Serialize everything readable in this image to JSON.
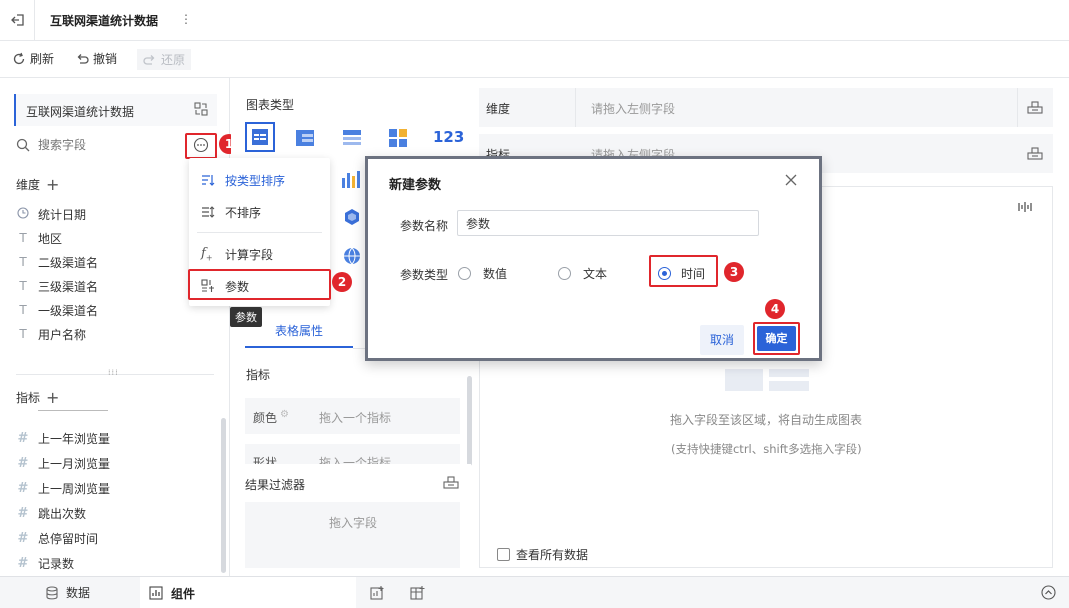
{
  "app": {
    "title": "互联网渠道统计数据",
    "more_glyph": "⋮"
  },
  "toolbar": {
    "refresh": "刷新",
    "undo": "撤销",
    "redo": "还原"
  },
  "left": {
    "dataset_name": "互联网渠道统计数据",
    "search_placeholder": "搜索字段",
    "dimension_title": "维度",
    "dimensions": [
      {
        "icon": "calendar-icon",
        "label": "统计日期"
      },
      {
        "icon": "text-field-icon",
        "label": "地区"
      },
      {
        "icon": "text-field-icon",
        "label": "二级渠道名"
      },
      {
        "icon": "text-field-icon",
        "label": "三级渠道名"
      },
      {
        "icon": "text-field-icon",
        "label": "一级渠道名"
      },
      {
        "icon": "text-field-icon",
        "label": "用户名称"
      }
    ],
    "metric_title": "指标",
    "metrics": [
      {
        "icon": "number-field-icon",
        "label": "上一年浏览量"
      },
      {
        "icon": "number-field-icon",
        "label": "上一月浏览量"
      },
      {
        "icon": "number-field-icon",
        "label": "上一周浏览量"
      },
      {
        "icon": "number-field-icon",
        "label": "跳出次数"
      },
      {
        "icon": "number-field-icon",
        "label": "总停留时间"
      },
      {
        "icon": "number-field-icon",
        "label": "记录数"
      }
    ]
  },
  "menu": {
    "items": [
      {
        "icon": "sort-by-type-icon",
        "label": "按类型排序"
      },
      {
        "icon": "no-sort-icon",
        "label": "不排序"
      },
      {
        "icon": "calc-field-icon",
        "label": "计算字段"
      },
      {
        "icon": "parameter-icon",
        "label": "参数"
      }
    ],
    "tooltip": "参数"
  },
  "middle": {
    "chart_type_title": "图表类型",
    "kpi_label": "123",
    "tab_table_props": "表格属性",
    "metric_section": "指标",
    "color_label": "颜色",
    "color_drop": "拖入一个指标",
    "shape_label": "形状",
    "shape_drop": "拖入一个指标",
    "filter_title": "结果过滤器",
    "filter_drop": "拖入字段"
  },
  "right": {
    "dimension_label": "维度",
    "dimension_drop": "请拖入左侧字段",
    "metric_label": "指标",
    "metric_drop": "请拖入左侧字段",
    "empty_hint": "拖入字段至该区域，将自动生成图表",
    "empty_sub": "(支持快捷键ctrl、shift多选拖入字段)",
    "view_all": "查看所有数据"
  },
  "dialog": {
    "title": "新建参数",
    "name_label": "参数名称",
    "name_value": "参数",
    "type_label": "参数类型",
    "options": [
      "数值",
      "文本",
      "时间"
    ],
    "selected_option": "时间",
    "cancel": "取消",
    "confirm": "确定"
  },
  "steps": [
    "1",
    "2",
    "3",
    "4"
  ],
  "bottom": {
    "tab_data": "数据",
    "tab_component": "组件"
  },
  "colors": {
    "accent": "#2b63d8",
    "annotation_red": "#e0262c",
    "dialog_border": "#6c7280"
  }
}
